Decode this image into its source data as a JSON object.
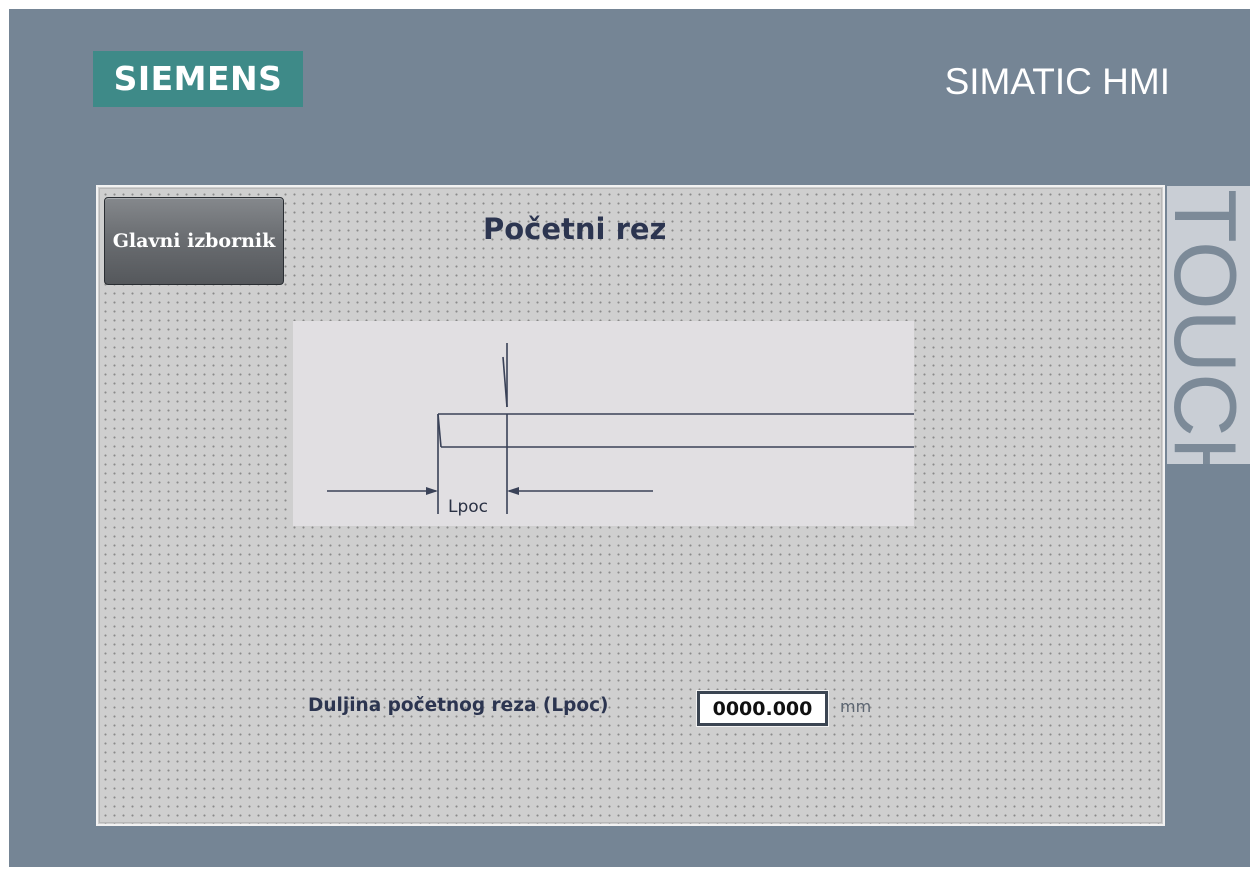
{
  "header": {
    "brand": "SIEMENS",
    "product": "SIMATIC HMI",
    "side_label": "TOUCH"
  },
  "screen": {
    "title": "Početni rez",
    "menu_button_label": "Glavni izbornik",
    "diagram": {
      "dimension_label": "Lpoc"
    },
    "field": {
      "label": "Duljina početnog reza (Lpoc)",
      "value": "0000.000",
      "unit": "mm"
    }
  },
  "colors": {
    "panel_background": "#758595",
    "brand_accent": "#3e8a88",
    "screen_background": "#cfcfcf",
    "title_text": "#2c3550"
  }
}
